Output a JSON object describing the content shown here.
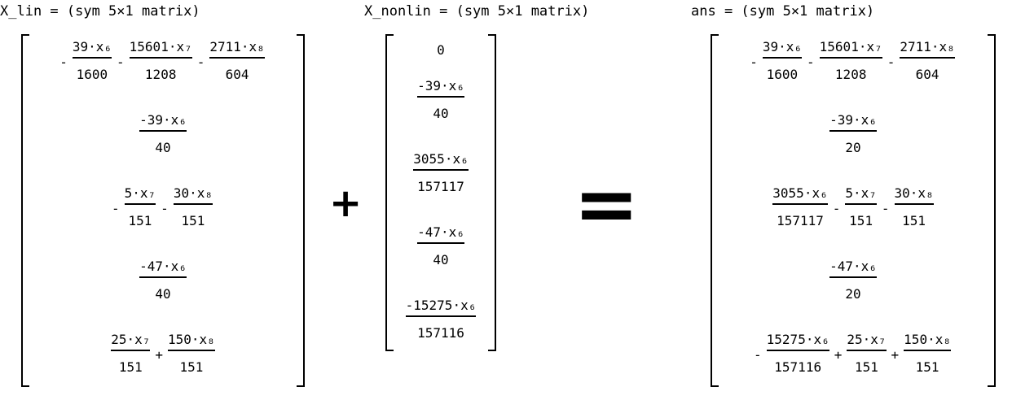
{
  "titles": {
    "x_lin": "X_lin = (sym 5×1 matrix)",
    "x_nonlin": "X_nonlin = (sym 5×1 matrix)",
    "ans": "ans = (sym 5×1 matrix)"
  },
  "operators": {
    "plus": "+",
    "equals": "="
  },
  "x_lin": [
    [
      "-",
      "39·x₆",
      "1600",
      "-",
      "15601·x₇",
      "1208",
      "-",
      "2711·x₈",
      "604"
    ],
    [
      "-39·x₆",
      "40"
    ],
    [
      "-",
      "5·x₇",
      "151",
      "-",
      "30·x₈",
      "151"
    ],
    [
      "-47·x₆",
      "40"
    ],
    [
      "25·x₇",
      "151",
      "+",
      "150·x₈",
      "151"
    ]
  ],
  "x_nonlin": [
    "0",
    "-39·x₆",
    "40",
    "3055·x₆",
    "157117",
    "-47·x₆",
    "40",
    "-15275·x₆",
    "157116"
  ],
  "ans": [
    [
      "-",
      "39·x₆",
      "1600",
      "-",
      "15601·x₇",
      "1208",
      "-",
      "2711·x₈",
      "604"
    ],
    [
      "-39·x₆",
      "20"
    ],
    [
      "3055·x₆",
      "157117",
      "-",
      "5·x₇",
      "151",
      "-",
      "30·x₈",
      "151"
    ],
    [
      "-47·x₆",
      "20"
    ],
    [
      "-",
      "15275·x₆",
      "157116",
      "+",
      "25·x₇",
      "151",
      "+",
      "150·x₈",
      "151"
    ]
  ]
}
